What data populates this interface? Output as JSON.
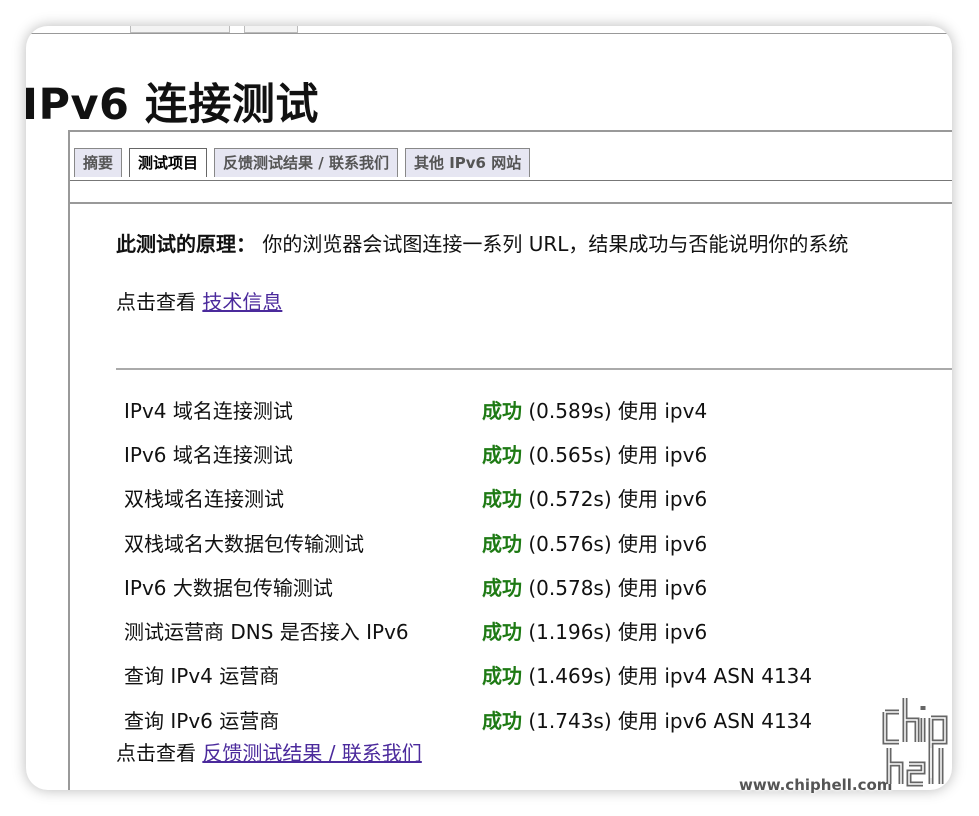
{
  "page": {
    "title": "IPv6 连接测试"
  },
  "tabs": [
    {
      "label": "摘要",
      "active": false
    },
    {
      "label": "测试项目",
      "active": true
    },
    {
      "label": "反馈测试结果 / 联系我们",
      "active": false
    },
    {
      "label": "其他 IPv6 网站",
      "active": false
    }
  ],
  "principle": {
    "label": "此测试的原理：",
    "text": "你的浏览器会试图连接一系列 URL，结果成功与否能说明你的系统"
  },
  "tech_link": {
    "prefix": "点击查看",
    "link": "技术信息"
  },
  "results": [
    {
      "name": "IPv4 域名连接测试",
      "status": "成功",
      "detail": "(0.589s) 使用 ipv4"
    },
    {
      "name": "IPv6 域名连接测试",
      "status": "成功",
      "detail": "(0.565s) 使用 ipv6"
    },
    {
      "name": "双栈域名连接测试",
      "status": "成功",
      "detail": "(0.572s) 使用 ipv6"
    },
    {
      "name": "双栈域名大数据包传输测试",
      "status": "成功",
      "detail": "(0.576s) 使用 ipv6"
    },
    {
      "name": "IPv6 大数据包传输测试",
      "status": "成功",
      "detail": "(0.578s) 使用 ipv6"
    },
    {
      "name": "测试运营商 DNS 是否接入 IPv6",
      "status": "成功",
      "detail": "(1.196s) 使用 ipv6"
    },
    {
      "name": "查询 IPv4 运营商",
      "status": "成功",
      "detail": "(1.469s) 使用 ipv4 ASN 4134"
    },
    {
      "name": "查询 IPv6 运营商",
      "status": "成功",
      "detail": "(1.743s) 使用 ipv6 ASN 4134"
    }
  ],
  "feedback_link": {
    "prefix": "点击查看",
    "link": "反馈测试结果 / 联系我们"
  },
  "watermark": {
    "text": "www.chiphell.com",
    "logo_name": "chiphell-logo"
  },
  "colors": {
    "success": "#1e7a14",
    "link": "#4b2a9c",
    "tab_bg": "#e6e6f2"
  }
}
